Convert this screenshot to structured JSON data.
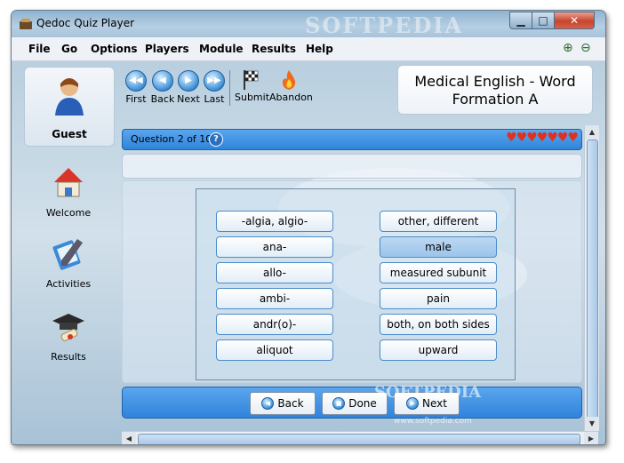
{
  "window": {
    "title": "Qedoc Quiz Player",
    "watermark": "SOFTPEDIA",
    "minimize_glyph": "▁",
    "maximize_glyph": "□",
    "close_glyph": "✕"
  },
  "menu": [
    "File",
    "Go",
    "Options",
    "Players",
    "Module",
    "Results",
    "Help"
  ],
  "zoom": {
    "in_icon": "⊕",
    "out_icon": "⊖"
  },
  "sidebar": {
    "user": "Guest",
    "items": [
      {
        "label": "Welcome",
        "icon": "house-icon"
      },
      {
        "label": "Activities",
        "icon": "notebook-pen-icon"
      },
      {
        "label": "Results",
        "icon": "graduation-cap-icon"
      }
    ]
  },
  "toolbar": {
    "first": "First",
    "back": "Back",
    "next": "Next",
    "last": "Last",
    "submit": "Submit",
    "abandon": "Abandon",
    "first_glyph": "◀◀",
    "back_glyph": "◀",
    "next_glyph": "▶",
    "last_glyph": "▶▶"
  },
  "module_title": "Medical English - Word Formation A",
  "question": {
    "label": "Question 2 of 10.",
    "help_glyph": "?",
    "hearts": "♥♥♥♥♥♥♥"
  },
  "left_terms": [
    "-algia, algio-",
    "ana-",
    "allo-",
    "ambi-",
    "andr(o)-",
    "aliquot"
  ],
  "right_terms": [
    "other, different",
    "male",
    "measured subunit",
    "pain",
    "both, on both sides",
    "upward"
  ],
  "nav": {
    "back": "Back",
    "done": "Done",
    "next": "Next",
    "back_glyph": "◀",
    "done_glyph": "■",
    "next_glyph": "▶"
  },
  "scroll": {
    "up": "▲",
    "down": "▼",
    "left": "◀",
    "right": "▶"
  },
  "watermark": {
    "text": "SOFTPEDIA",
    "url": "www.softpedia.com"
  }
}
